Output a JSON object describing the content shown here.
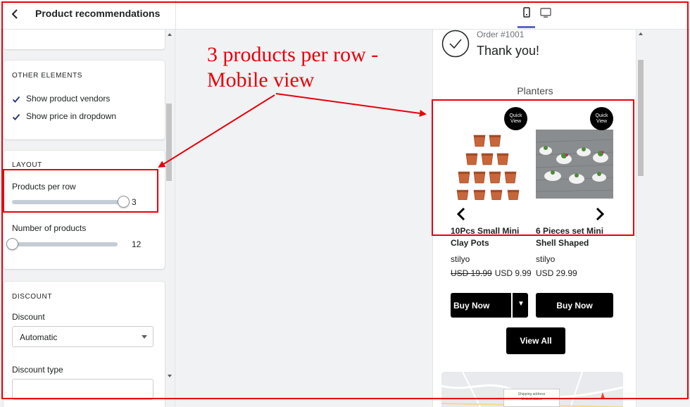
{
  "header": {
    "title": "Product recommendations",
    "back_icon": "chevron-left-icon",
    "device_mobile_icon": "mobile-icon",
    "device_desktop_icon": "desktop-icon"
  },
  "sidebar": {
    "other_elements": {
      "heading": "OTHER ELEMENTS",
      "show_vendors": {
        "label": "Show product vendors",
        "checked": true
      },
      "show_price": {
        "label": "Show price in dropdown",
        "checked": true
      }
    },
    "layout": {
      "heading": "LAYOUT",
      "products_per_row": {
        "label": "Products per row",
        "value": "3",
        "fraction": 1.0
      },
      "number_of_products": {
        "label": "Number of products",
        "value": "12",
        "fraction": 0.0
      }
    },
    "discount": {
      "heading": "DISCOUNT",
      "discount_label": "Discount",
      "discount_value": "Automatic",
      "discount_type_label": "Discount type"
    }
  },
  "preview": {
    "order_number": "Order #1001",
    "thank_you": "Thank you!",
    "collection_title": "Planters",
    "quick_view": "Quick View",
    "products": [
      {
        "name": "10Pcs Small Mini Clay Pots",
        "vendor": "stilyo",
        "old_price": "USD 19.99",
        "price": "USD 9.99"
      },
      {
        "name": "6 Pieces set Mini Shell Shaped",
        "vendor": "stilyo",
        "old_price": "",
        "price": "USD 29.99"
      }
    ],
    "buy_now": "Buy Now",
    "view_all": "View All",
    "map_label_1": "Shipping address",
    "map_label_2": "United states"
  },
  "annotation": {
    "line1": "3 products per row -",
    "line2": "Mobile view",
    "color": "#e8000b"
  }
}
